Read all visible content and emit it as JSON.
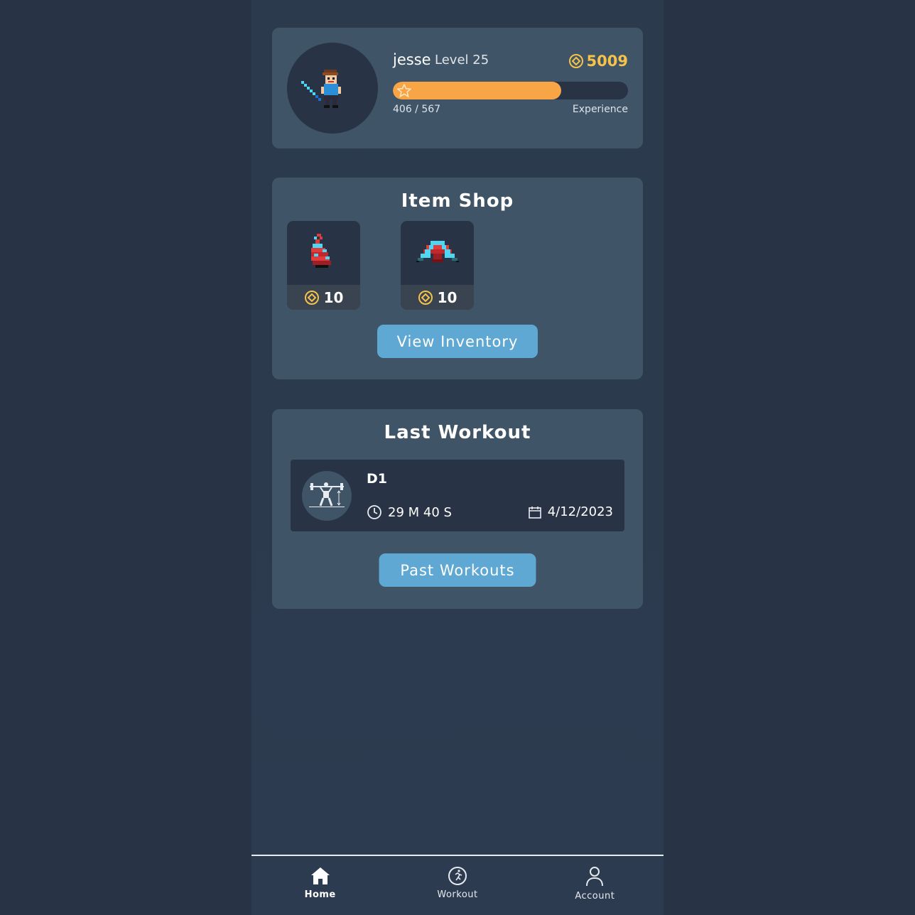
{
  "profile": {
    "username": "jesse",
    "level_label": "Level 25",
    "coins": "5009",
    "xp_current_text": "406 / 567",
    "xp_fraction": 0.716,
    "xp_label": "Experience"
  },
  "shop": {
    "title": "Item Shop",
    "items": [
      {
        "name": "potion",
        "price": "10"
      },
      {
        "name": "helmet",
        "price": "10"
      }
    ],
    "button_label": "View Inventory"
  },
  "last_workout": {
    "title": "Last Workout",
    "name": "D1",
    "duration": "29 M 40 S",
    "date": "4/12/2023",
    "button_label": "Past Workouts"
  },
  "nav": {
    "items": [
      {
        "label": "Home",
        "icon": "home-icon",
        "active": true
      },
      {
        "label": "Workout",
        "icon": "run-icon",
        "active": false
      },
      {
        "label": "Account",
        "icon": "user-icon",
        "active": false
      }
    ]
  },
  "colors": {
    "background": "#283345",
    "card": "#3f5467",
    "accent_button": "#5ea8d3",
    "xp_bar": "#f7a545",
    "coin": "#f6c24a"
  }
}
